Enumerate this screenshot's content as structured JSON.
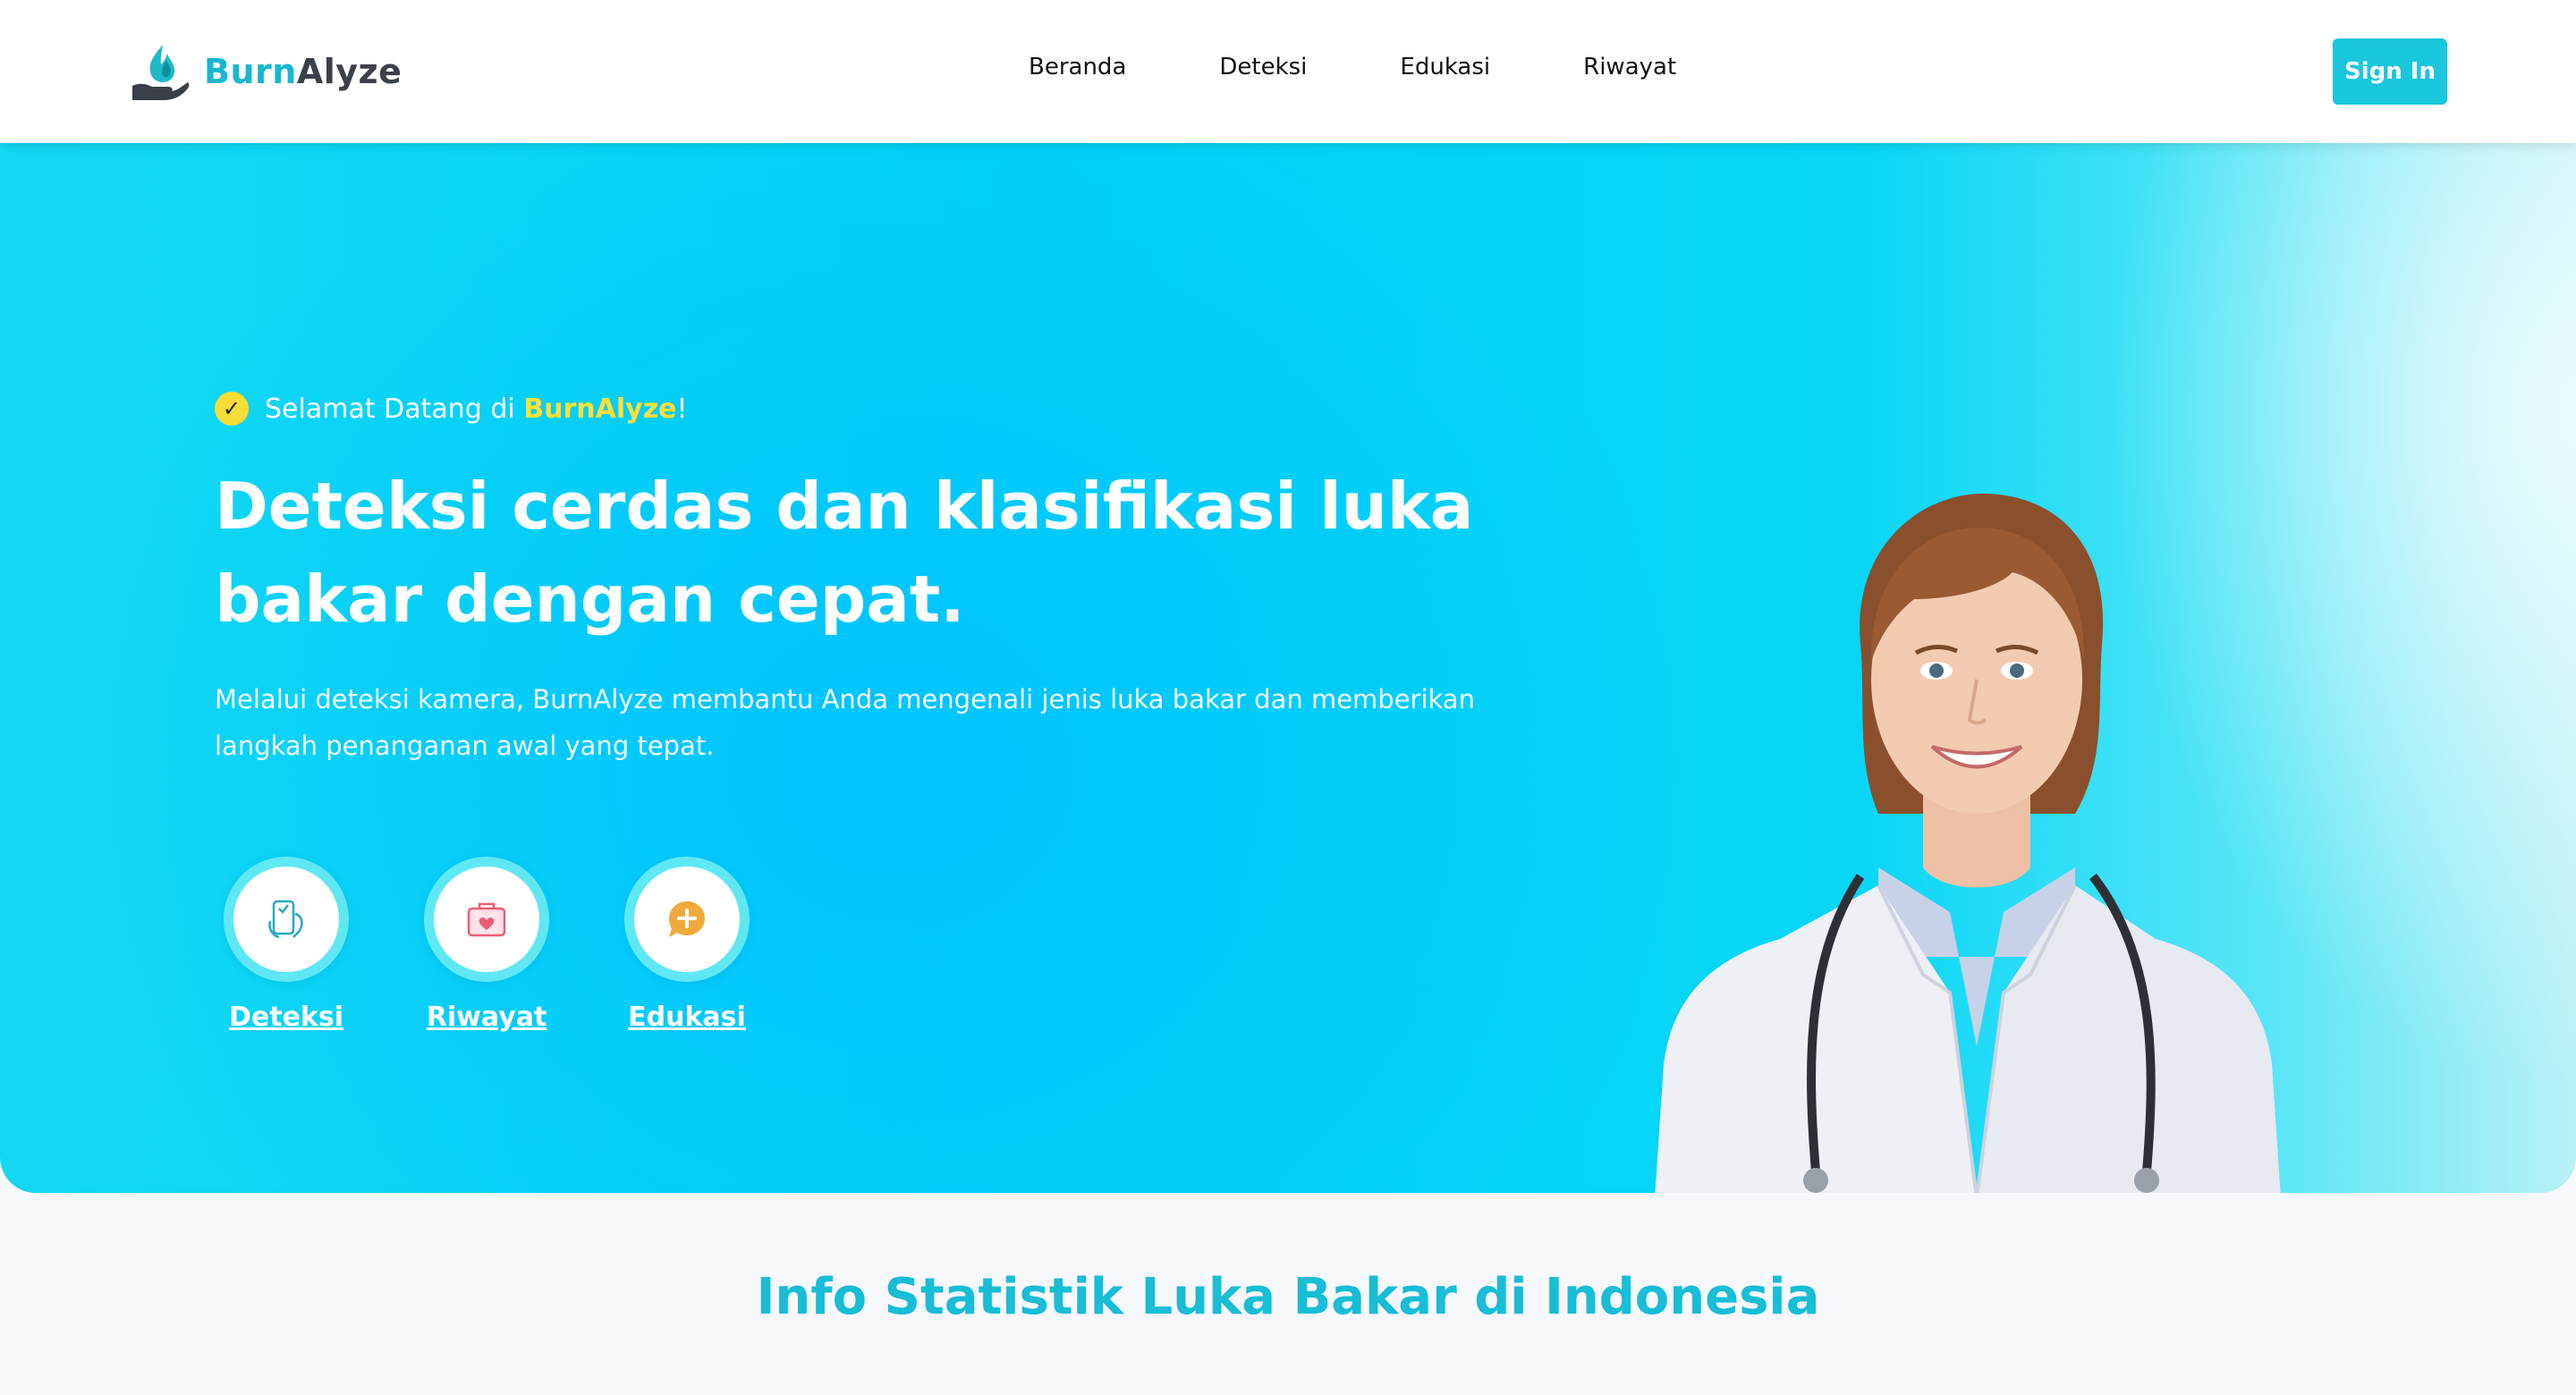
{
  "brand": {
    "part1": "Burn",
    "part2": "Alyze",
    "logo_icon": "flame-hand-icon"
  },
  "nav": {
    "items": [
      {
        "label": "Beranda"
      },
      {
        "label": "Deteksi"
      },
      {
        "label": "Edukasi"
      },
      {
        "label": "Riwayat"
      }
    ],
    "signin_label": "Sign In"
  },
  "hero": {
    "welcome_prefix": "Selamat Datang di ",
    "welcome_brand": "BurnAlyze",
    "welcome_suffix": "!",
    "check_icon": "✓",
    "headline": "Deteksi cerdas dan klasifikasi luka bakar dengan cepat.",
    "subtext": "Melalui deteksi kamera, BurnAlyze membantu Anda mengenali jenis luka bakar dan memberikan langkah penanganan awal yang tepat.",
    "quick_links": [
      {
        "label": "Deteksi",
        "icon": "phone-scan-icon"
      },
      {
        "label": "Riwayat",
        "icon": "medical-briefcase-icon"
      },
      {
        "label": "Edukasi",
        "icon": "chat-plus-icon"
      }
    ]
  },
  "stats": {
    "title": "Info Statistik Luka Bakar di Indonesia"
  },
  "colors": {
    "accent": "#19c7dc",
    "brand_teal": "#17b7cf",
    "welcome_yellow": "#ffe036",
    "hero_cyan": "#00d3f6"
  }
}
